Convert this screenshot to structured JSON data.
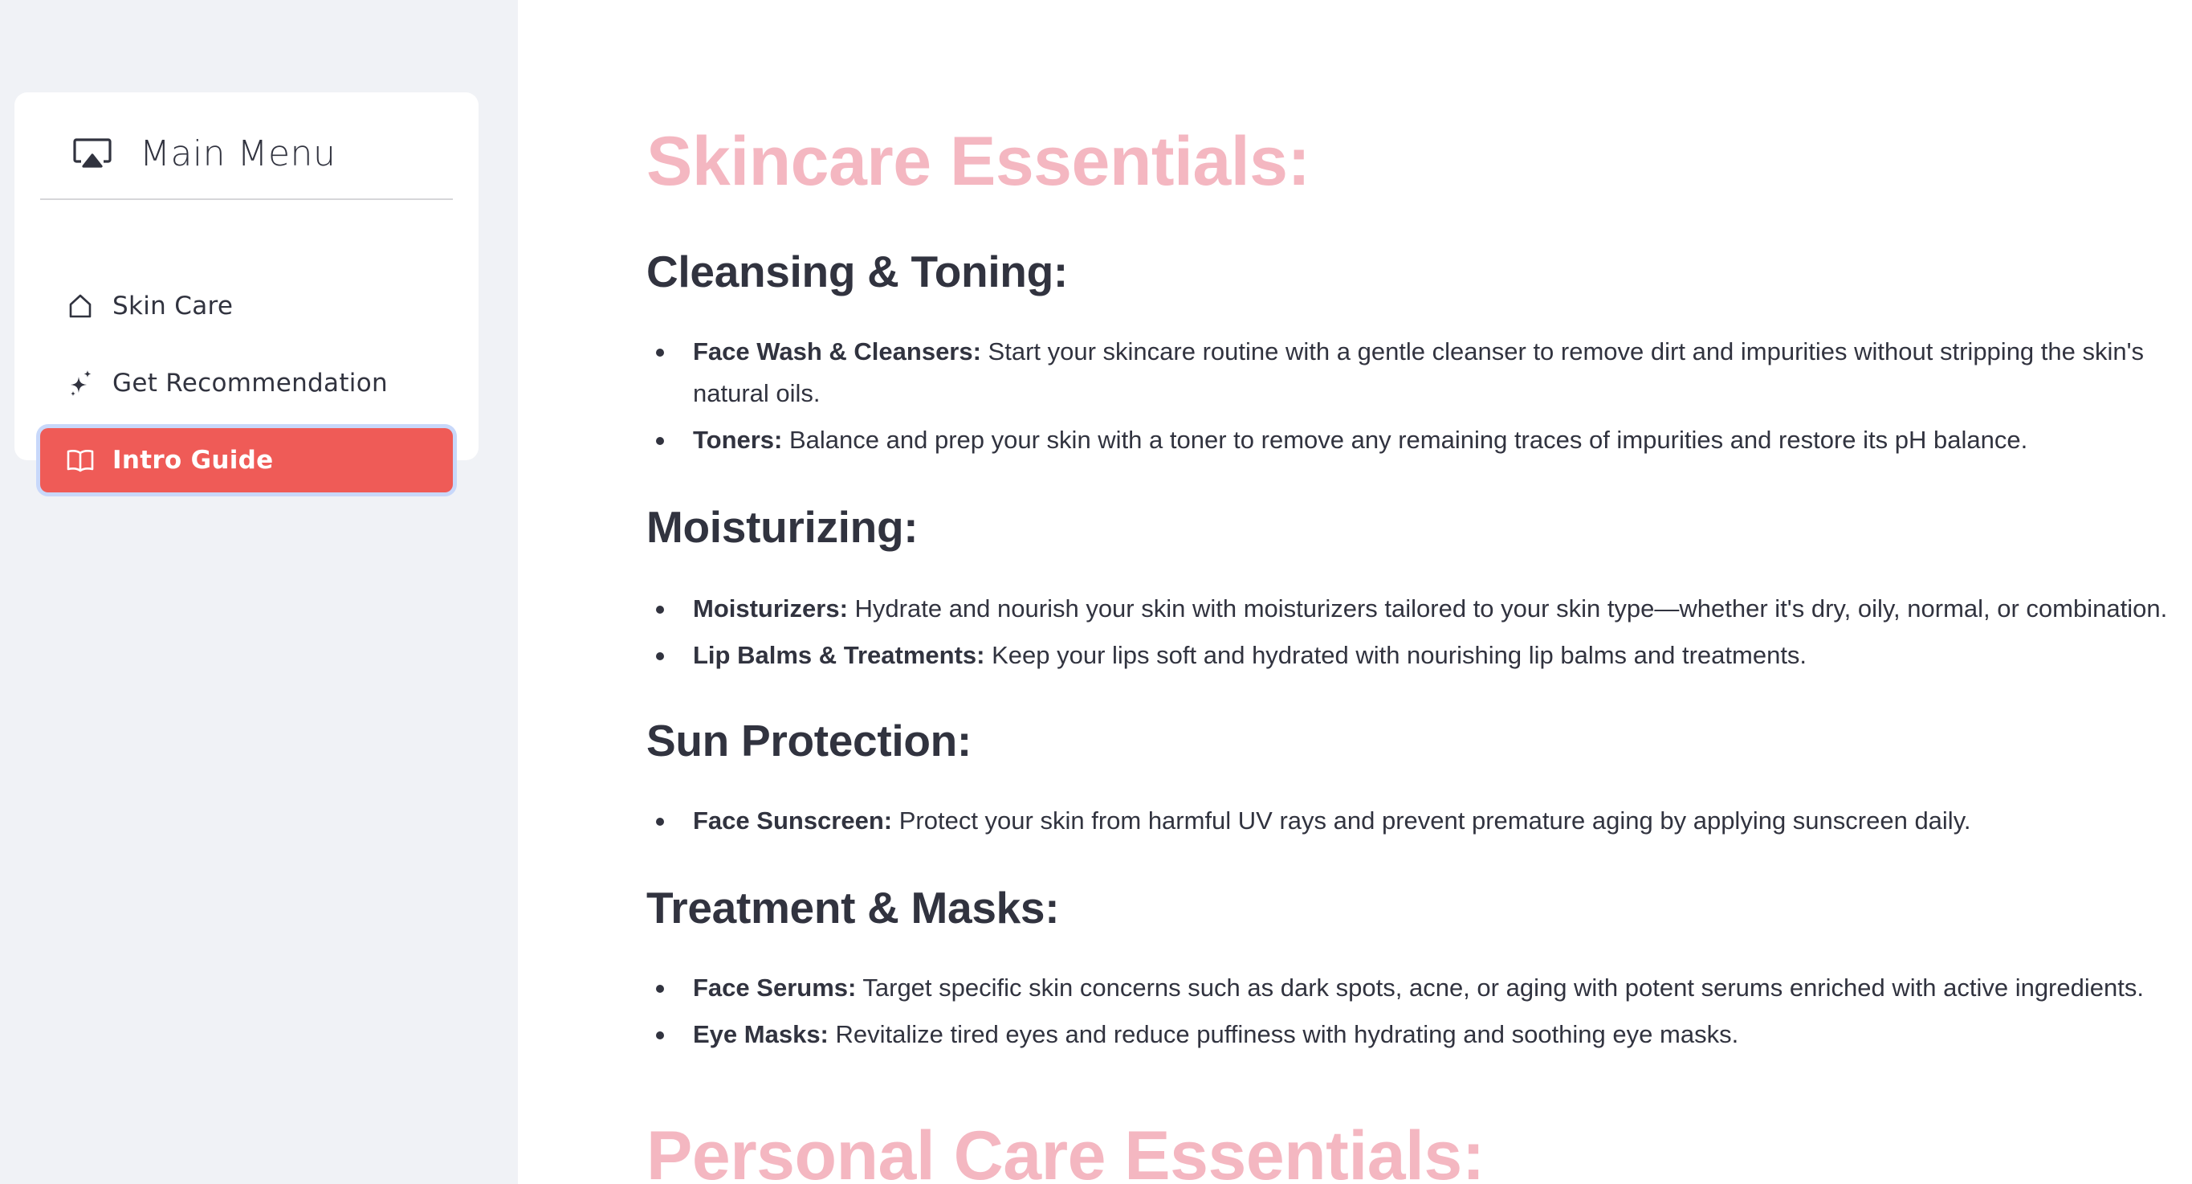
{
  "sidebar": {
    "header": {
      "title": "Main Menu",
      "icon": "airplay-icon"
    },
    "items": [
      {
        "label": "Skin Care",
        "icon": "home-icon",
        "active": false
      },
      {
        "label": "Get Recommendation",
        "icon": "sparkles-icon",
        "active": false
      },
      {
        "label": "Intro Guide",
        "icon": "book-icon",
        "active": true
      }
    ],
    "active_color": "#ef5b57"
  },
  "main": {
    "skincare": {
      "title": "Skincare Essentials:",
      "sections": [
        {
          "heading": "Cleansing & Toning:",
          "items": [
            {
              "term": "Face Wash & Cleansers:",
              "text": " Start your skincare routine with a gentle cleanser to remove dirt and impurities without stripping the skin's natural oils."
            },
            {
              "term": "Toners:",
              "text": " Balance and prep your skin with a toner to remove any remaining traces of impurities and restore its pH balance."
            }
          ]
        },
        {
          "heading": "Moisturizing:",
          "items": [
            {
              "term": "Moisturizers:",
              "text": " Hydrate and nourish your skin with moisturizers tailored to your skin type—whether it's dry, oily, normal, or combination."
            },
            {
              "term": "Lip Balms & Treatments:",
              "text": " Keep your lips soft and hydrated with nourishing lip balms and treatments."
            }
          ]
        },
        {
          "heading": "Sun Protection:",
          "items": [
            {
              "term": "Face Sunscreen:",
              "text": " Protect your skin from harmful UV rays and prevent premature aging by applying sunscreen daily."
            }
          ]
        },
        {
          "heading": "Treatment & Masks:",
          "items": [
            {
              "term": "Face Serums:",
              "text": " Target specific skin concerns such as dark spots, acne, or aging with potent serums enriched with active ingredients."
            },
            {
              "term": "Eye Masks:",
              "text": " Revitalize tired eyes and reduce puffiness with hydrating and soothing eye masks."
            }
          ]
        }
      ]
    },
    "personal_care": {
      "title": "Personal Care Essentials:"
    },
    "title_color": "#f4b7c1"
  }
}
